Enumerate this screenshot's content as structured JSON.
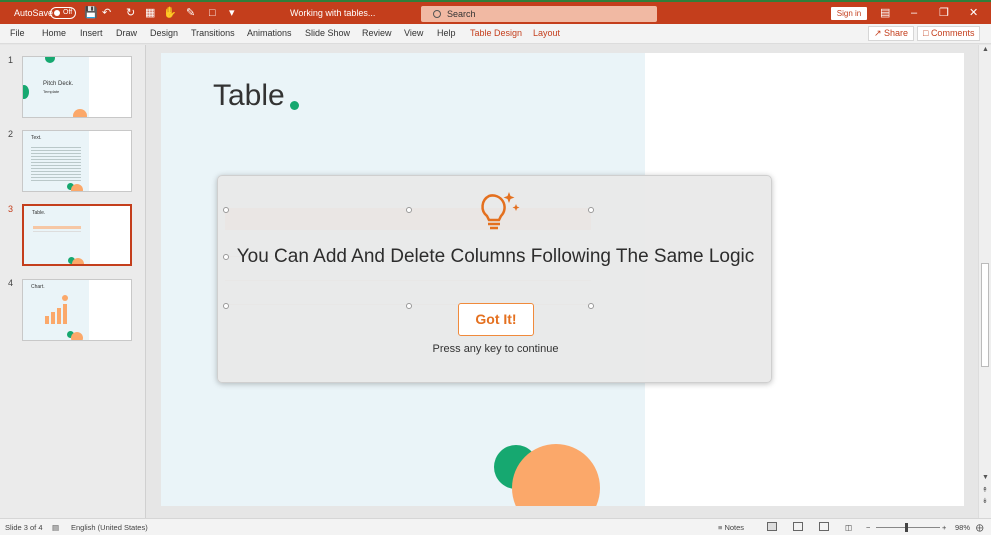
{
  "titlebar": {
    "autosave_label": "AutoSave",
    "autosave_state": "Off",
    "document_title": "Working with tables...",
    "search_placeholder": "Search",
    "signin_label": "Sign in"
  },
  "ribbon": {
    "tabs": [
      {
        "label": "File"
      },
      {
        "label": "Home"
      },
      {
        "label": "Insert"
      },
      {
        "label": "Draw"
      },
      {
        "label": "Design"
      },
      {
        "label": "Transitions"
      },
      {
        "label": "Animations"
      },
      {
        "label": "Slide Show"
      },
      {
        "label": "Review"
      },
      {
        "label": "View"
      },
      {
        "label": "Help"
      },
      {
        "label": "Table Design"
      },
      {
        "label": "Layout"
      }
    ],
    "share_label": "Share",
    "comments_label": "Comments"
  },
  "slides": [
    {
      "number": "1",
      "title": "Pitch Deck.",
      "subtitle": "Template"
    },
    {
      "number": "2",
      "title": "Text."
    },
    {
      "number": "3",
      "title": "Table."
    },
    {
      "number": "4",
      "title": "Chart."
    }
  ],
  "current_slide": {
    "title": "Table"
  },
  "dialog": {
    "message": "You Can Add And Delete Columns Following The Same Logic",
    "button_label": "Got It!",
    "hint": "Press any key to continue"
  },
  "statusbar": {
    "slide_position": "Slide 3 of 4",
    "language": "English (United States)",
    "notes_label": "Notes",
    "zoom": "98%"
  },
  "colors": {
    "accent": "#c43e1c",
    "green": "#16a870",
    "orange": "#fba86a"
  }
}
